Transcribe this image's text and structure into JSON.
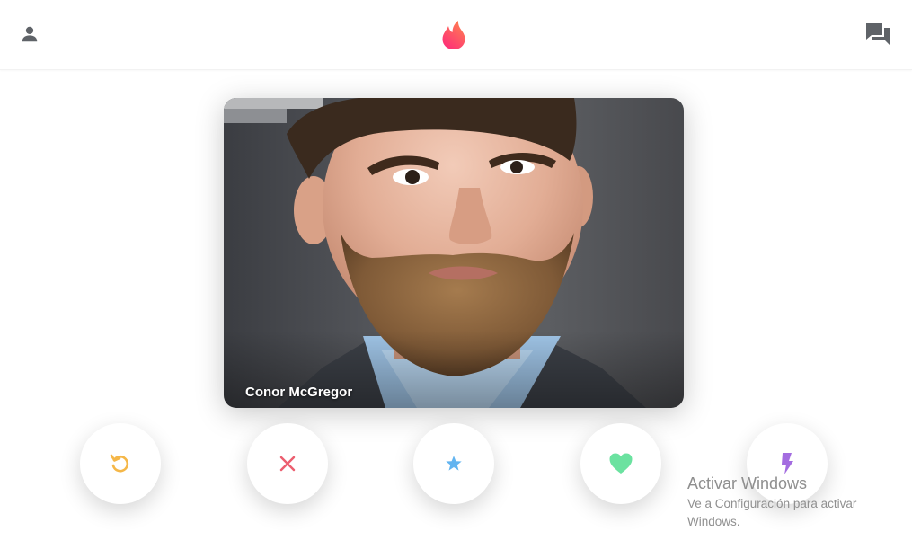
{
  "header": {
    "left_icon": "person-icon",
    "center_icon": "flame-logo-icon",
    "right_icon": "chat-bubbles-icon"
  },
  "card": {
    "name": "Conor McGregor"
  },
  "actions": [
    {
      "icon": "rewind-icon",
      "color": "#f5b748"
    },
    {
      "icon": "close-icon",
      "color": "#ec5e6f"
    },
    {
      "icon": "star-icon",
      "color": "#62b4f0"
    },
    {
      "icon": "heart-icon",
      "color": "#6be2a0"
    },
    {
      "icon": "lightning-icon",
      "color": "#a36ce0"
    }
  ],
  "colors": {
    "brand_gradient_start": "#fd267d",
    "brand_gradient_end": "#ff7854",
    "header_icon": "#5f6368"
  },
  "watermark": {
    "title": "Activar Windows",
    "subtitle": "Ve a Configuración para activar Windows."
  }
}
